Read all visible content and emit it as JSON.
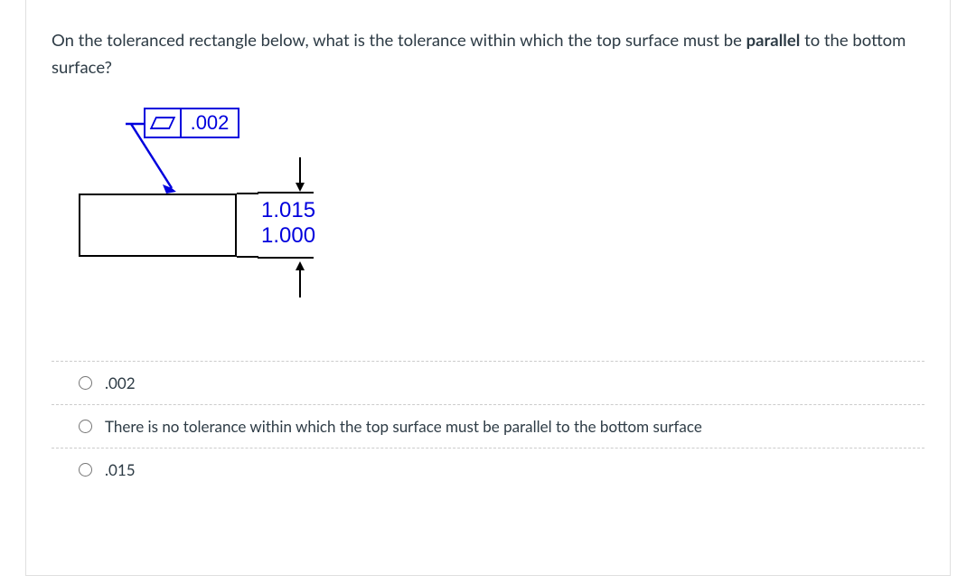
{
  "question": {
    "text_before_bold": "On the toleranced rectangle below, what is the tolerance within which the top surface must be ",
    "bold_word": "parallel",
    "text_after_bold": " to the bottom surface?"
  },
  "diagram": {
    "fcf_value": ".002",
    "dim_upper": "1.015",
    "dim_lower": "1.000"
  },
  "options": [
    {
      "label": ".002"
    },
    {
      "label": "There is no tolerance within which the top surface must be parallel to the bottom surface"
    },
    {
      "label": ".015"
    }
  ]
}
